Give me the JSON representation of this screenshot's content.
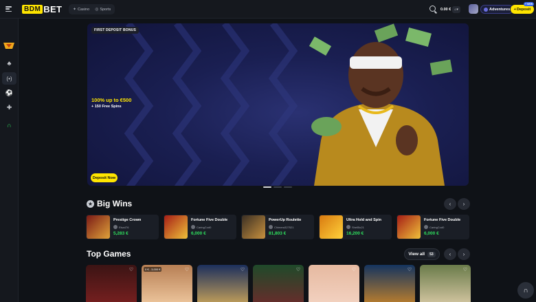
{
  "header": {
    "logo_left": "BDM",
    "logo_right": "BET",
    "modes": [
      {
        "label": "Casino",
        "icon": "dice-icon"
      },
      {
        "label": "Sports",
        "icon": "ball-icon"
      }
    ],
    "balance": "0.00 €",
    "adventures_label": "Adventures",
    "deposit_label": "Deposit",
    "new_badge": "+ NEW"
  },
  "hero": {
    "tag": "FIRST DEPOSIT BONUS",
    "title": "100% up to €500",
    "subtitle": "+ 150 Free Spins",
    "button": "Deposit Now",
    "slides": 3,
    "active_slide": 1
  },
  "big_wins": {
    "title": "Big Wins",
    "items": [
      {
        "game": "Prestige Crown",
        "user": "Elsa476",
        "amount": "5,283 €",
        "thumb": "#7a1a16"
      },
      {
        "game": "Fortune Five Double",
        "user": "CaringCod0",
        "amount": "6,000 €",
        "thumb": "#a51d16"
      },
      {
        "game": "PowerUp Roulette",
        "user": "Chimera327521",
        "amount": "81,803 €",
        "thumb": "#3a2f24"
      },
      {
        "game": "Ultra Hold and Spin",
        "user": "Shell5o21",
        "amount": "16,200 €",
        "thumb": "#d97a10"
      },
      {
        "game": "Fortune Five Double",
        "user": "CaringCod0",
        "amount": "6,000 €",
        "thumb": "#a51d16"
      }
    ]
  },
  "top_games": {
    "title": "Top Games",
    "view_all": "View all",
    "count": "53",
    "items": [
      {
        "limit": "",
        "color_a": "#3b1414",
        "color_b": "#7a2020"
      },
      {
        "limit": "0 € - 3,000 €",
        "color_a": "#b77f54",
        "color_b": "#f0c9a0"
      },
      {
        "limit": "",
        "color_a": "#1c2f5c",
        "color_b": "#caa45a"
      },
      {
        "limit": "",
        "color_a": "#1f4a2a",
        "color_b": "#6b2b2b"
      },
      {
        "limit": "",
        "color_a": "#e6b9a0",
        "color_b": "#f3d3c2"
      },
      {
        "limit": "",
        "color_a": "#15345f",
        "color_b": "#c3822b"
      },
      {
        "limit": "",
        "color_a": "#6a7b4a",
        "color_b": "#d8c9a5"
      }
    ]
  }
}
